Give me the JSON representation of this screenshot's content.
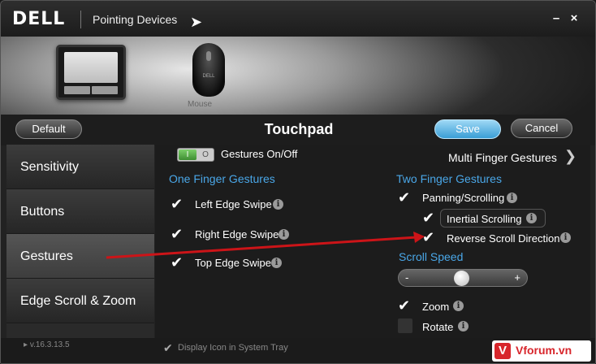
{
  "window": {
    "logo": "DELL",
    "app_title": "Pointing Devices",
    "minimize_glyph": "–",
    "close_glyph": "×"
  },
  "devices": {
    "mouse_brand": "DELL",
    "mouse_label": "Mouse"
  },
  "toolbar": {
    "default_label": "Default",
    "page_title": "Touchpad",
    "save_label": "Save",
    "cancel_label": "Cancel"
  },
  "sidebar": {
    "items": [
      {
        "label": "Sensitivity",
        "active": false
      },
      {
        "label": "Buttons",
        "active": false
      },
      {
        "label": "Gestures",
        "active": true
      },
      {
        "label": "Edge Scroll & Zoom",
        "active": false
      }
    ]
  },
  "gestures": {
    "toggle_on": "I",
    "toggle_off": "O",
    "toggle_label": "Gestures On/Off",
    "multi_finger_link": "Multi Finger Gestures",
    "one_finger_title": "One Finger Gestures",
    "one_finger": [
      {
        "label": "Left Edge Swipe",
        "checked": true
      },
      {
        "label": "Right Edge Swipe",
        "checked": true
      },
      {
        "label": "Top Edge Swipe",
        "checked": true
      }
    ],
    "two_finger_title": "Two Finger Gestures",
    "two_finger": [
      {
        "label": "Panning/Scrolling",
        "checked": true
      },
      {
        "label": "Inertial Scrolling",
        "checked": true
      },
      {
        "label": "Reverse Scroll Direction",
        "checked": true
      }
    ],
    "scroll_speed_title": "Scroll Speed",
    "scroll_speed_min": "-",
    "scroll_speed_max": "+",
    "scroll_speed_value": 0.5,
    "zoom": {
      "label": "Zoom",
      "checked": true
    },
    "rotate": {
      "label": "Rotate",
      "checked": false
    },
    "info_glyph": "i"
  },
  "status": {
    "version": "v.16.3.13.5",
    "tray_label": "Display Icon in System Tray",
    "tray_checked": true
  },
  "watermark": {
    "badge": "V",
    "text": "Vforum.vn"
  },
  "colors": {
    "accent_blue": "#4aa7e8",
    "save_button": "#3a9ed6",
    "annotation_arrow": "#cc1418"
  }
}
